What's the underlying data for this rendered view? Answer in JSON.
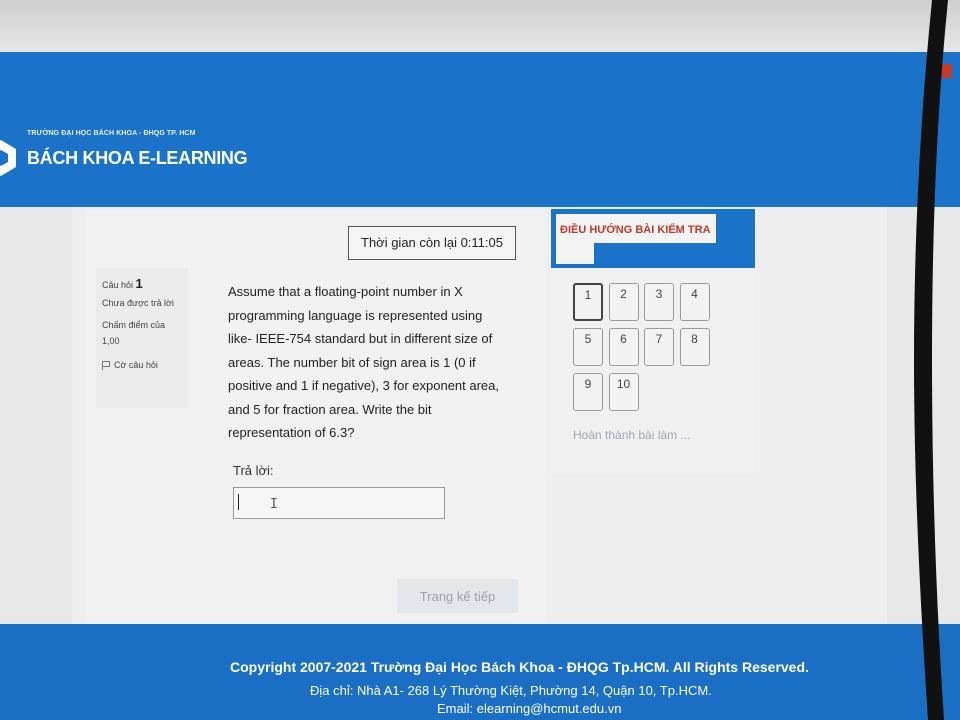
{
  "header": {
    "subtitle": "TRƯỜNG ĐẠI HỌC BÁCH KHOA - ĐHQG TP. HCM",
    "title": "BÁCH KHOA E-LEARNING"
  },
  "timer": {
    "text": "Thời gian còn lại 0:11:05"
  },
  "question_info": {
    "label": "Câu hỏi",
    "number": "1",
    "status": "Chưa được trả lời",
    "grade": "Chấm điểm của 1,00",
    "flag_label": "Cờ câu hỏi"
  },
  "question": {
    "text": "Assume that a floating-point number in X programming language is represented using like- IEEE-754 standard but in different size of areas. The number bit of sign area is 1 (0 if positive and 1 if negative), 3 for exponent area, and 5 for fraction area. Write the bit representation of 6.3?",
    "answer_label": "Trả lời:",
    "answer_value": ""
  },
  "next_button": "Trang kế tiếp",
  "navigation": {
    "title": "ĐIỀU HƯỚNG BÀI KIỂM TRA",
    "questions": [
      "1",
      "2",
      "3",
      "4",
      "5",
      "6",
      "7",
      "8",
      "9",
      "10"
    ],
    "current": "1",
    "finish_link": "Hoàn thành bài làm ..."
  },
  "footer": {
    "copyright": "Copyright 2007-2021 Trường Đại Học Bách Khoa - ĐHQG Tp.HCM. All Rights Reserved.",
    "address": "Địa chỉ: Nhà A1- 268 Lý Thường Kiệt, Phường 14, Quận 10, Tp.HCM.",
    "email": "Email: elearning@hcmut.edu.vn"
  },
  "colors": {
    "brand_blue": "#1a73c9",
    "nav_title_red": "#c0392b"
  }
}
